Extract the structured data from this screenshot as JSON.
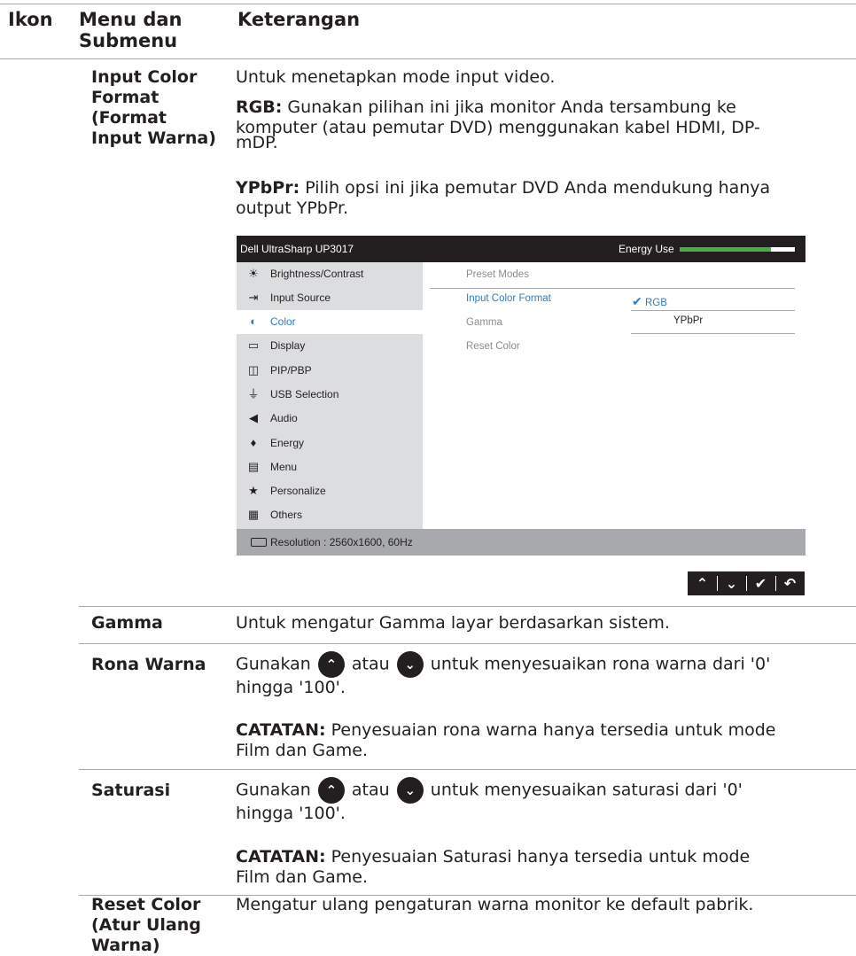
{
  "table_header": {
    "col_icon": "Ikon",
    "col_menu_line1": "Menu dan",
    "col_menu_line2": "Submenu",
    "col_desc": "Keterangan"
  },
  "row_input_color": {
    "title_lines": [
      "Input Color",
      "Format",
      "(Format",
      "Input Warna)"
    ],
    "intro": "Untuk menetapkan mode input video.",
    "rgb_label": "RGB:",
    "rgb_line1": " Gunakan pilihan ini jika monitor Anda tersambung ke",
    "rgb_line2": "komputer (atau pemutar DVD) menggunakan kabel HDMI, DP-",
    "rgb_line3": "mDP.",
    "ypbpr_label": "YPbPr:",
    "ypbpr_line1": " Pilih opsi ini jika pemutar DVD Anda mendukung hanya",
    "ypbpr_line2": "output YPbPr."
  },
  "osd": {
    "title": "Dell UltraSharp UP3017",
    "energy_label": "Energy Use",
    "energy_level": 0.79,
    "menu": [
      {
        "icon": "brightness-icon",
        "glyph": "☀",
        "label": "Brightness/Contrast"
      },
      {
        "icon": "input-source-icon",
        "glyph": "⇥",
        "label": "Input Source"
      },
      {
        "icon": "color-icon",
        "glyph": "◐",
        "label": "Color"
      },
      {
        "icon": "display-icon",
        "glyph": "▭",
        "label": "Display"
      },
      {
        "icon": "pip-pbp-icon",
        "glyph": "◫",
        "label": "PIP/PBP"
      },
      {
        "icon": "usb-selection-icon",
        "glyph": "⏚",
        "label": "USB Selection"
      },
      {
        "icon": "audio-icon",
        "glyph": "◀",
        "label": "Audio"
      },
      {
        "icon": "energy-icon",
        "glyph": "♦",
        "label": "Energy"
      },
      {
        "icon": "menu-icon",
        "glyph": "▤",
        "label": "Menu"
      },
      {
        "icon": "personalize-icon",
        "glyph": "★",
        "label": "Personalize"
      },
      {
        "icon": "others-icon",
        "glyph": "▦",
        "label": "Others"
      }
    ],
    "submenu": [
      "Preset Modes",
      "Input Color Format",
      "Gamma",
      "Reset Color"
    ],
    "options": [
      "RGB",
      "YPbPr"
    ],
    "check_glyph": "✔",
    "resolution": "Resolution : 2560x1600, 60Hz",
    "colors": {
      "title_bg": "#231f20",
      "menu_bg": "#dcdddf",
      "accent": "#2f7dc4",
      "energy": "#4bac45",
      "footer_bg": "#a7a9ac"
    }
  },
  "nav_buttons": [
    {
      "icon": "up-icon",
      "glyph": "⌃"
    },
    {
      "icon": "down-icon",
      "glyph": "⌄"
    },
    {
      "icon": "check-icon",
      "glyph": "✔"
    },
    {
      "icon": "back-icon",
      "glyph": "↶"
    }
  ],
  "row_gamma": {
    "title": "Gamma",
    "desc": "Untuk mengatur Gamma layar berdasarkan sistem."
  },
  "row_hue": {
    "title": "Rona Warna",
    "p1_a": "Gunakan",
    "p1_b": "atau",
    "p1_c": "untuk menyesuaikan rona warna dari '0'",
    "p1_line2": "hingga '100'.",
    "note_label": "CATATAN:",
    "note_line1": " Penyesuaian rona warna hanya tersedia untuk mode",
    "note_line2": "Film dan Game."
  },
  "row_saturation": {
    "title": "Saturasi",
    "p1_a": "Gunakan",
    "p1_b": "atau",
    "p1_c": "untuk menyesuaikan saturasi dari '0'",
    "p1_line2": "hingga '100'.",
    "note_label": "CATATAN:",
    "note_line1": " Penyesuaian Saturasi hanya tersedia untuk mode",
    "note_line2": "Film dan Game."
  },
  "row_reset": {
    "title_lines": [
      "Reset Color",
      "(Atur Ulang",
      "Warna)"
    ],
    "desc": "Mengatur ulang pengaturan warna monitor ke default pabrik."
  },
  "arrow_up_glyph": "⌃",
  "arrow_down_glyph": "⌄"
}
